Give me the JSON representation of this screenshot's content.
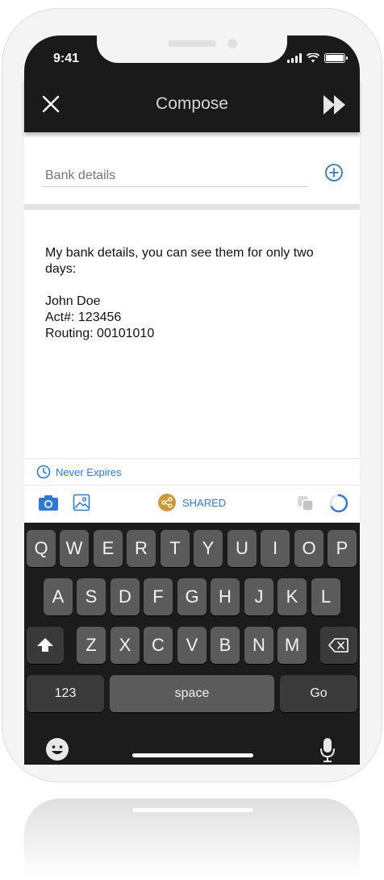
{
  "status_bar": {
    "time": "9:41"
  },
  "header": {
    "title": "Compose"
  },
  "subject": {
    "placeholder": "Bank details"
  },
  "message": {
    "intro": "My bank details, you can see them for only two days:",
    "lines": [
      "John Doe",
      "Act#: 123456",
      "Routing: 00101010"
    ]
  },
  "expiry": {
    "label": "Never Expires"
  },
  "toolbar": {
    "shared_label": "SHARED"
  },
  "keyboard": {
    "row1": [
      "Q",
      "W",
      "E",
      "R",
      "T",
      "Y",
      "U",
      "I",
      "O",
      "P"
    ],
    "row2": [
      "A",
      "S",
      "D",
      "F",
      "G",
      "H",
      "J",
      "K",
      "L"
    ],
    "row3": [
      "Z",
      "X",
      "C",
      "V",
      "B",
      "N",
      "M"
    ],
    "numbers_label": "123",
    "space_label": "space",
    "go_label": "Go"
  },
  "colors": {
    "accent": "#2f79d3",
    "shared_gold": "#c9993a",
    "nav_bg": "#1a1a1a"
  },
  "icons": [
    "close-icon",
    "send-icon",
    "add-icon",
    "clock-icon",
    "camera-icon",
    "image-icon",
    "share-icon",
    "copy-icon",
    "progress-icon",
    "shift-icon",
    "backspace-icon",
    "emoji-icon",
    "microphone-icon"
  ]
}
